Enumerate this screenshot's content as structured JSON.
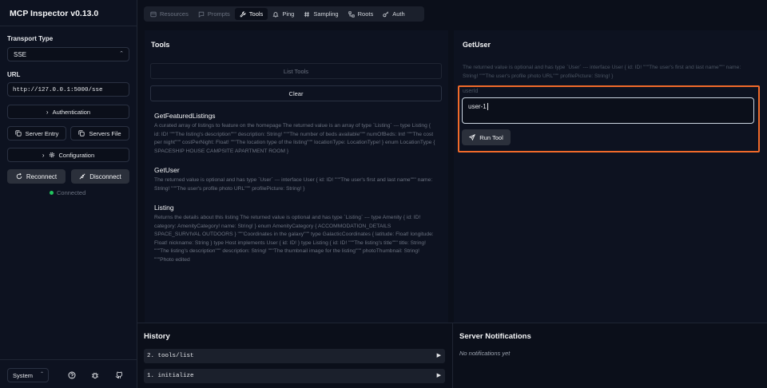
{
  "app": {
    "title": "MCP Inspector v0.13.0"
  },
  "sidebar": {
    "transport_label": "Transport Type",
    "transport_value": "SSE",
    "url_label": "URL",
    "url_value": "http://127.0.0.1:5000/sse",
    "authentication_label": "Authentication",
    "server_entry_label": "Server Entry",
    "servers_file_label": "Servers File",
    "configuration_label": "Configuration",
    "reconnect_label": "Reconnect",
    "disconnect_label": "Disconnect",
    "status_text": "Connected",
    "status_color": "#22c55e",
    "theme_value": "System"
  },
  "tabs": [
    {
      "label": "Resources",
      "icon": "resources-icon"
    },
    {
      "label": "Prompts",
      "icon": "prompts-icon"
    },
    {
      "label": "Tools",
      "icon": "tools-icon",
      "active": true
    },
    {
      "label": "Ping",
      "icon": "bell-icon"
    },
    {
      "label": "Sampling",
      "icon": "hash-icon"
    },
    {
      "label": "Roots",
      "icon": "roots-icon"
    },
    {
      "label": "Auth",
      "icon": "key-icon"
    }
  ],
  "tools_panel": {
    "title": "Tools",
    "list_tools_label": "List Tools",
    "clear_label": "Clear",
    "items": [
      {
        "name": "GetFeaturedListings",
        "description": "A curated array of listings to feature on the homepage The returned value is an array of type `Listing` --- type Listing { id: ID! \"\"\"The listing's description\"\"\" description: String! \"\"\"The number of beds available\"\"\" numOfBeds: Int! \"\"\"The cost per night\"\"\" costPerNight: Float! \"\"\"The location type of the listing\"\"\" locationType: LocationType! } enum LocationType { SPACESHIP HOUSE CAMPSITE APARTMENT ROOM }"
      },
      {
        "name": "GetUser",
        "description": "The returned value is optional and has type `User` --- interface User { id: ID! \"\"\"The user's first and last name\"\"\" name: String! \"\"\"The user's profile photo URL\"\"\" profilePicture: String! }"
      },
      {
        "name": "Listing",
        "description": "Returns the details about this listing The returned value is optional and has type `Listing` --- type Amenity { id: ID! category: AmenityCategory! name: String! } enum AmenityCategory { ACCOMMODATION_DETAILS SPACE_SURVIVAL OUTDOORS } \"\"\"Coordinates in the galaxy\"\"\" type GalacticCoordinates { latitude: Float! longitude: Float! nickname: String } type Host implements User { id: ID! } type Listing { id: ID! \"\"\"The listing's title\"\"\" title: String! \"\"\"The listing's description\"\"\" description: String! \"\"\"The thumbnail image for the listing\"\"\" photoThumbnail: String! \"\"\"Photo edited"
      }
    ]
  },
  "detail_panel": {
    "title": "GetUser",
    "description": "The returned value is optional and has type `User` --- interface User { id: ID! \"\"\"The user's first and last name\"\"\" name: String! \"\"\"The user's profile photo URL\"\"\" profilePicture: String! }",
    "param_label": "userId",
    "param_value": "user-1",
    "run_label": "Run Tool",
    "highlight_color": "#f06a2a"
  },
  "history": {
    "title": "History",
    "items": [
      "2. tools/list",
      "1. initialize"
    ]
  },
  "notifications": {
    "title": "Server Notifications",
    "empty_text": "No notifications yet"
  }
}
